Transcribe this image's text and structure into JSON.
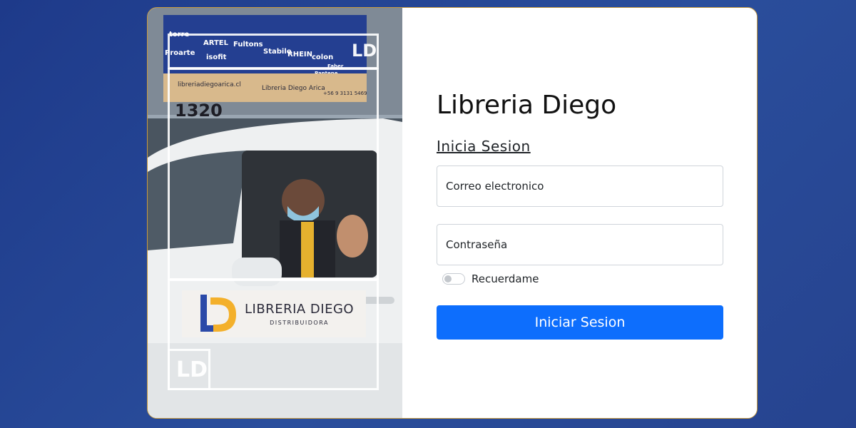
{
  "brand": {
    "title": "Libreria Diego",
    "logo_name": "LIBRERIA DIEGO",
    "logo_subtitle": "DISTRIBUIDORA",
    "logo_initials": "LD",
    "accent_color": "#f3b02b",
    "logo_blue": "#2b4aa8"
  },
  "form": {
    "login_link": "Inicia Sesion",
    "email_placeholder": "Correo electronico",
    "password_placeholder": "Contraseña",
    "remember_label": "Recuerdame",
    "remember_checked": false,
    "submit_label": "Iniciar Sesion",
    "submit_color": "#0d6efd"
  },
  "storefront": {
    "website": "libreriadiegoarica.cl",
    "social": "Libreria Diego Arica",
    "phone": "+56 9 3131 5469",
    "street_number": "1320",
    "brands": [
      "torre",
      "ARTEL",
      "Fultons",
      "Proarte",
      "isofit",
      "Stabilo",
      "RHEIN",
      "colon",
      "Pelikan",
      "Faber",
      "Pantene"
    ]
  }
}
